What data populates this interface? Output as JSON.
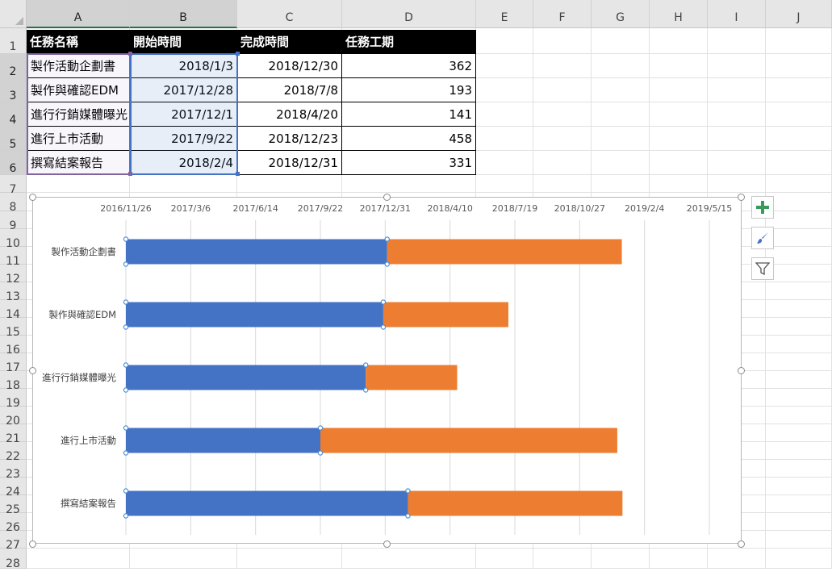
{
  "columns": [
    "A",
    "B",
    "C",
    "D",
    "E",
    "F",
    "G",
    "H",
    "I",
    "J"
  ],
  "rows": [
    "1",
    "2",
    "3",
    "4",
    "5",
    "6",
    "7",
    "8",
    "9",
    "10",
    "11",
    "12",
    "13",
    "14",
    "15",
    "16",
    "17",
    "18",
    "19",
    "20",
    "21",
    "22",
    "23",
    "24",
    "25",
    "26",
    "27",
    "28"
  ],
  "table": {
    "headers": [
      "任務名稱",
      "開始時間",
      "完成時間",
      "任務工期"
    ],
    "rows": [
      [
        "製作活動企劃書",
        "2018/1/3",
        "2018/12/30",
        "362"
      ],
      [
        "製作與確認EDM",
        "2017/12/28",
        "2018/7/8",
        "193"
      ],
      [
        "進行行銷媒體曝光",
        "2017/12/1",
        "2018/4/20",
        "141"
      ],
      [
        "進行上市活動",
        "2017/9/22",
        "2018/12/23",
        "458"
      ],
      [
        "撰寫結案報告",
        "2018/2/4",
        "2018/12/31",
        "331"
      ]
    ]
  },
  "chart_data": {
    "type": "bar",
    "orientation": "horizontal",
    "stacked": true,
    "categories": [
      "製作活動企劃書",
      "製作與確認EDM",
      "進行行銷媒體曝光",
      "進行上市活動",
      "撰寫結案報告"
    ],
    "series": [
      {
        "values": [
          "2018/1/3",
          "2017/12/28",
          "2017/12/1",
          "2017/9/22",
          "2018/2/4"
        ],
        "color": "#4472c4"
      },
      {
        "values": [
          362,
          193,
          141,
          458,
          331
        ],
        "unit": "days",
        "color": "#ed7d31"
      }
    ],
    "x_axis": {
      "position": "top",
      "tick_labels": [
        "2016/11/26",
        "2017/3/6",
        "2017/6/14",
        "2017/9/22",
        "2017/12/31",
        "2018/4/10",
        "2018/7/19",
        "2018/10/27",
        "2019/2/4",
        "2019/5/15"
      ],
      "range": [
        "2016/11/26",
        "2019/5/15"
      ],
      "major_unit_days": 100
    },
    "gridlines": "vertical"
  },
  "chart_tools": {
    "icons": [
      "plus-icon",
      "brush-icon",
      "filter-icon"
    ]
  }
}
